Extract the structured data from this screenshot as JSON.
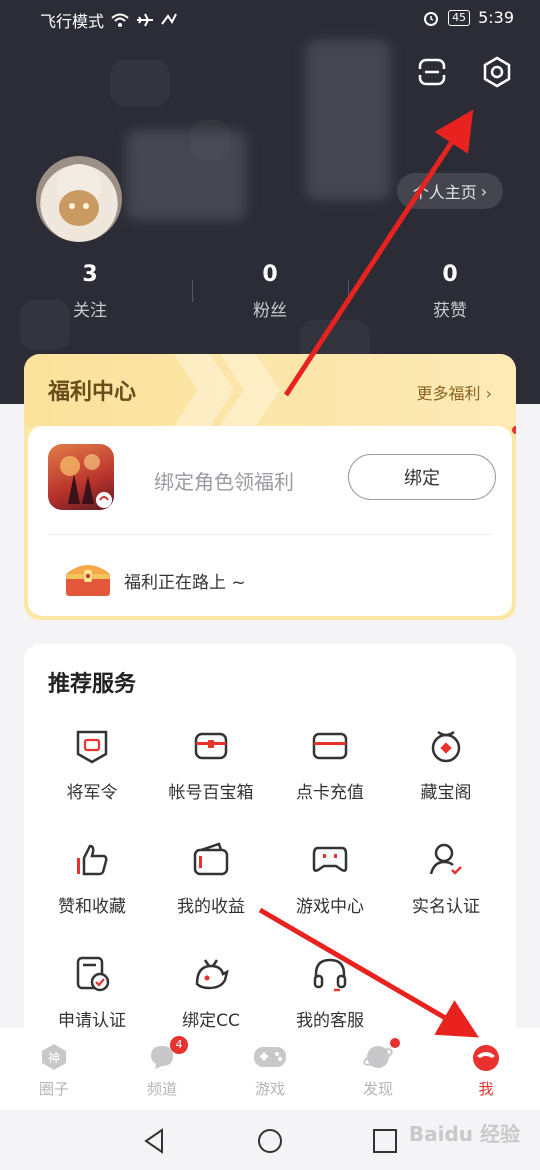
{
  "statusbar": {
    "left_text": "飞行模式",
    "battery": "45",
    "time": "5:39"
  },
  "header": {
    "scan_icon": "scan-icon",
    "settings_icon": "settings-hexagon-icon",
    "homepage_label": "个人主页",
    "stats": [
      {
        "value": "3",
        "label": "关注"
      },
      {
        "value": "0",
        "label": "粉丝"
      },
      {
        "value": "0",
        "label": "获赞"
      }
    ]
  },
  "welfare": {
    "title": "福利中心",
    "more": "更多福利",
    "bind_text": "绑定角色领福利",
    "bind_button": "绑定",
    "on_road": "福利正在路上 ~"
  },
  "services": {
    "title": "推荐服务",
    "items": [
      {
        "label": "将军令",
        "icon": "shield-token-icon"
      },
      {
        "label": "帐号百宝箱",
        "icon": "treasure-box-icon"
      },
      {
        "label": "点卡充值",
        "icon": "card-recharge-icon"
      },
      {
        "label": "藏宝阁",
        "icon": "treasure-pavilion-icon"
      },
      {
        "label": "赞和收藏",
        "icon": "thumbs-up-icon"
      },
      {
        "label": "我的收益",
        "icon": "wallet-icon"
      },
      {
        "label": "游戏中心",
        "icon": "gamepad-icon"
      },
      {
        "label": "实名认证",
        "icon": "user-verify-icon"
      },
      {
        "label": "申请认证",
        "icon": "apply-cert-icon"
      },
      {
        "label": "绑定CC",
        "icon": "cc-bind-icon"
      },
      {
        "label": "我的客服",
        "icon": "headset-icon"
      }
    ]
  },
  "tabbar": {
    "items": [
      {
        "label": "圈子",
        "icon": "circle-tab-icon"
      },
      {
        "label": "频道",
        "icon": "channel-tab-icon",
        "badge": "4"
      },
      {
        "label": "游戏",
        "icon": "game-tab-icon"
      },
      {
        "label": "发现",
        "icon": "discover-tab-icon"
      },
      {
        "label": "我",
        "icon": "me-tab-icon"
      }
    ]
  },
  "watermark": "Baidu 经验",
  "colors": {
    "accent": "#e8322e",
    "header_bg": "#2b2c36",
    "welfare_bg": "#fde7a6"
  }
}
